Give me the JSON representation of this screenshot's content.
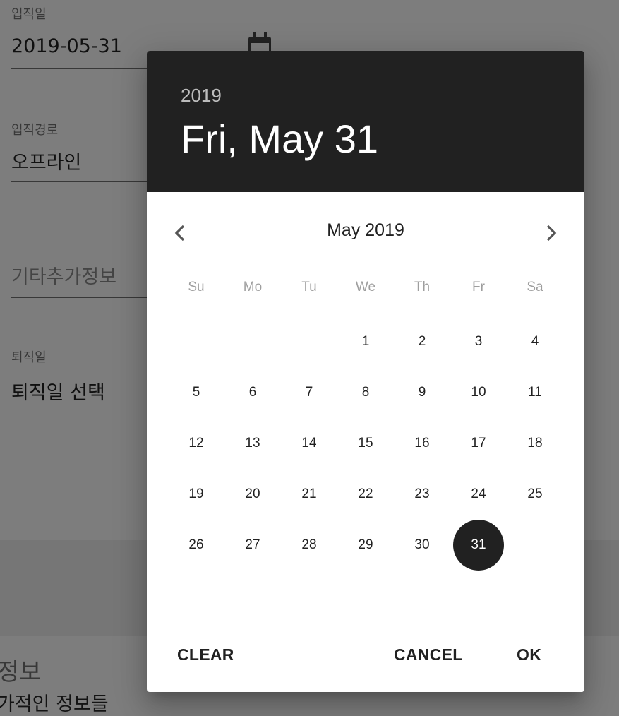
{
  "form": {
    "hire_date": {
      "label": "입직일",
      "value": "2019-05-31"
    },
    "hire_route": {
      "label": "입직경로",
      "value": "오프라인"
    },
    "extra_info": {
      "placeholder": "기타추가정보"
    },
    "leave_date": {
      "label": "퇴직일",
      "value": "퇴직일 선택"
    },
    "section_title": "정보",
    "section_sub": "가적인 정보들"
  },
  "date_picker": {
    "header_year": "2019",
    "header_date": "Fri, May 31",
    "month_label": "May 2019",
    "prev_icon": "chevron-left-icon",
    "next_icon": "chevron-right-icon",
    "weekdays": [
      "Su",
      "Mo",
      "Tu",
      "We",
      "Th",
      "Fr",
      "Sa"
    ],
    "first_weekday_index": 3,
    "days_in_month": 31,
    "selected_day": 31,
    "actions": {
      "clear": "CLEAR",
      "cancel": "CANCEL",
      "ok": "OK"
    }
  },
  "colors": {
    "header_bg": "#212121",
    "selected_bg": "#212121"
  }
}
